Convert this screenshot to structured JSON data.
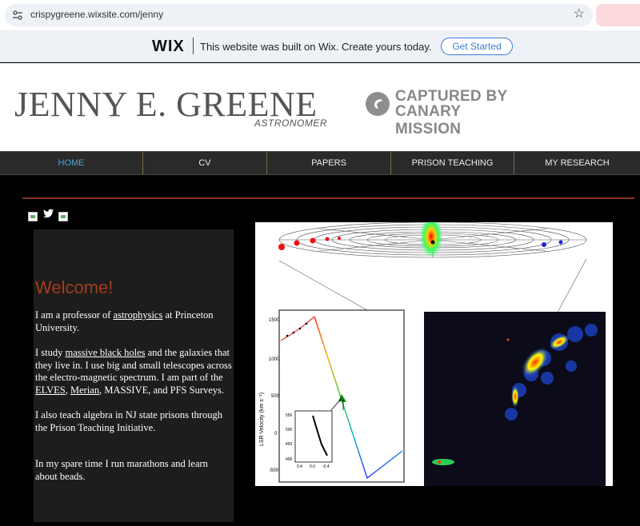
{
  "browser": {
    "url": "crispygreene.wixsite.com/jenny"
  },
  "wix_banner": {
    "logo": "WIX",
    "message": "This website was built on Wix. Create yours today.",
    "cta": "Get Started"
  },
  "header": {
    "site_name": "JENNY E. GREENE",
    "subtitle": "ASTRONOMER",
    "badge_line1": "CAPTURED BY",
    "badge_line2": "CANARY MISSION"
  },
  "nav": {
    "items": [
      {
        "label": "HOME",
        "active": true
      },
      {
        "label": "CV"
      },
      {
        "label": "PAPERS"
      },
      {
        "label": "PRISON TEACHING"
      },
      {
        "label": "MY RESEARCH"
      }
    ]
  },
  "welcome": {
    "title": "Welcome!",
    "p1_a": "I am a professor of ",
    "p1_link": "astrophysics",
    "p1_b": " at Princeton University.",
    "p2_a": "I study ",
    "p2_link1": "massive black holes",
    "p2_b": " and the galaxies that they live in. I use big and small telescopes across the electro-magnetic spectrum. I am part of the ",
    "p2_link2": "ELVES",
    "p2_c": ", ",
    "p2_link3": "Merian",
    "p2_d": ", MASSIVE, and PFS Surveys.",
    "p3": " I also teach algebra in NJ state prisons through the Prison Teaching Initiative.",
    "p4": "In my spare time I run marathons and learn about beads."
  },
  "figure": {
    "ylabel": "LSR Velocity (km s⁻¹)",
    "yticks": [
      "1500",
      "1000",
      "500",
      "0",
      "-500"
    ],
    "inset_yticks": [
      "550",
      "500",
      "450",
      "400"
    ],
    "inset_xticks": [
      "0.4",
      "0.0",
      "-0.4"
    ]
  },
  "colors": {
    "accent_rule": "#8b3a1f",
    "welcome_title": "#a43c1e",
    "nav_active": "#4aa3df",
    "wix_cta": "#3b7dd8"
  }
}
